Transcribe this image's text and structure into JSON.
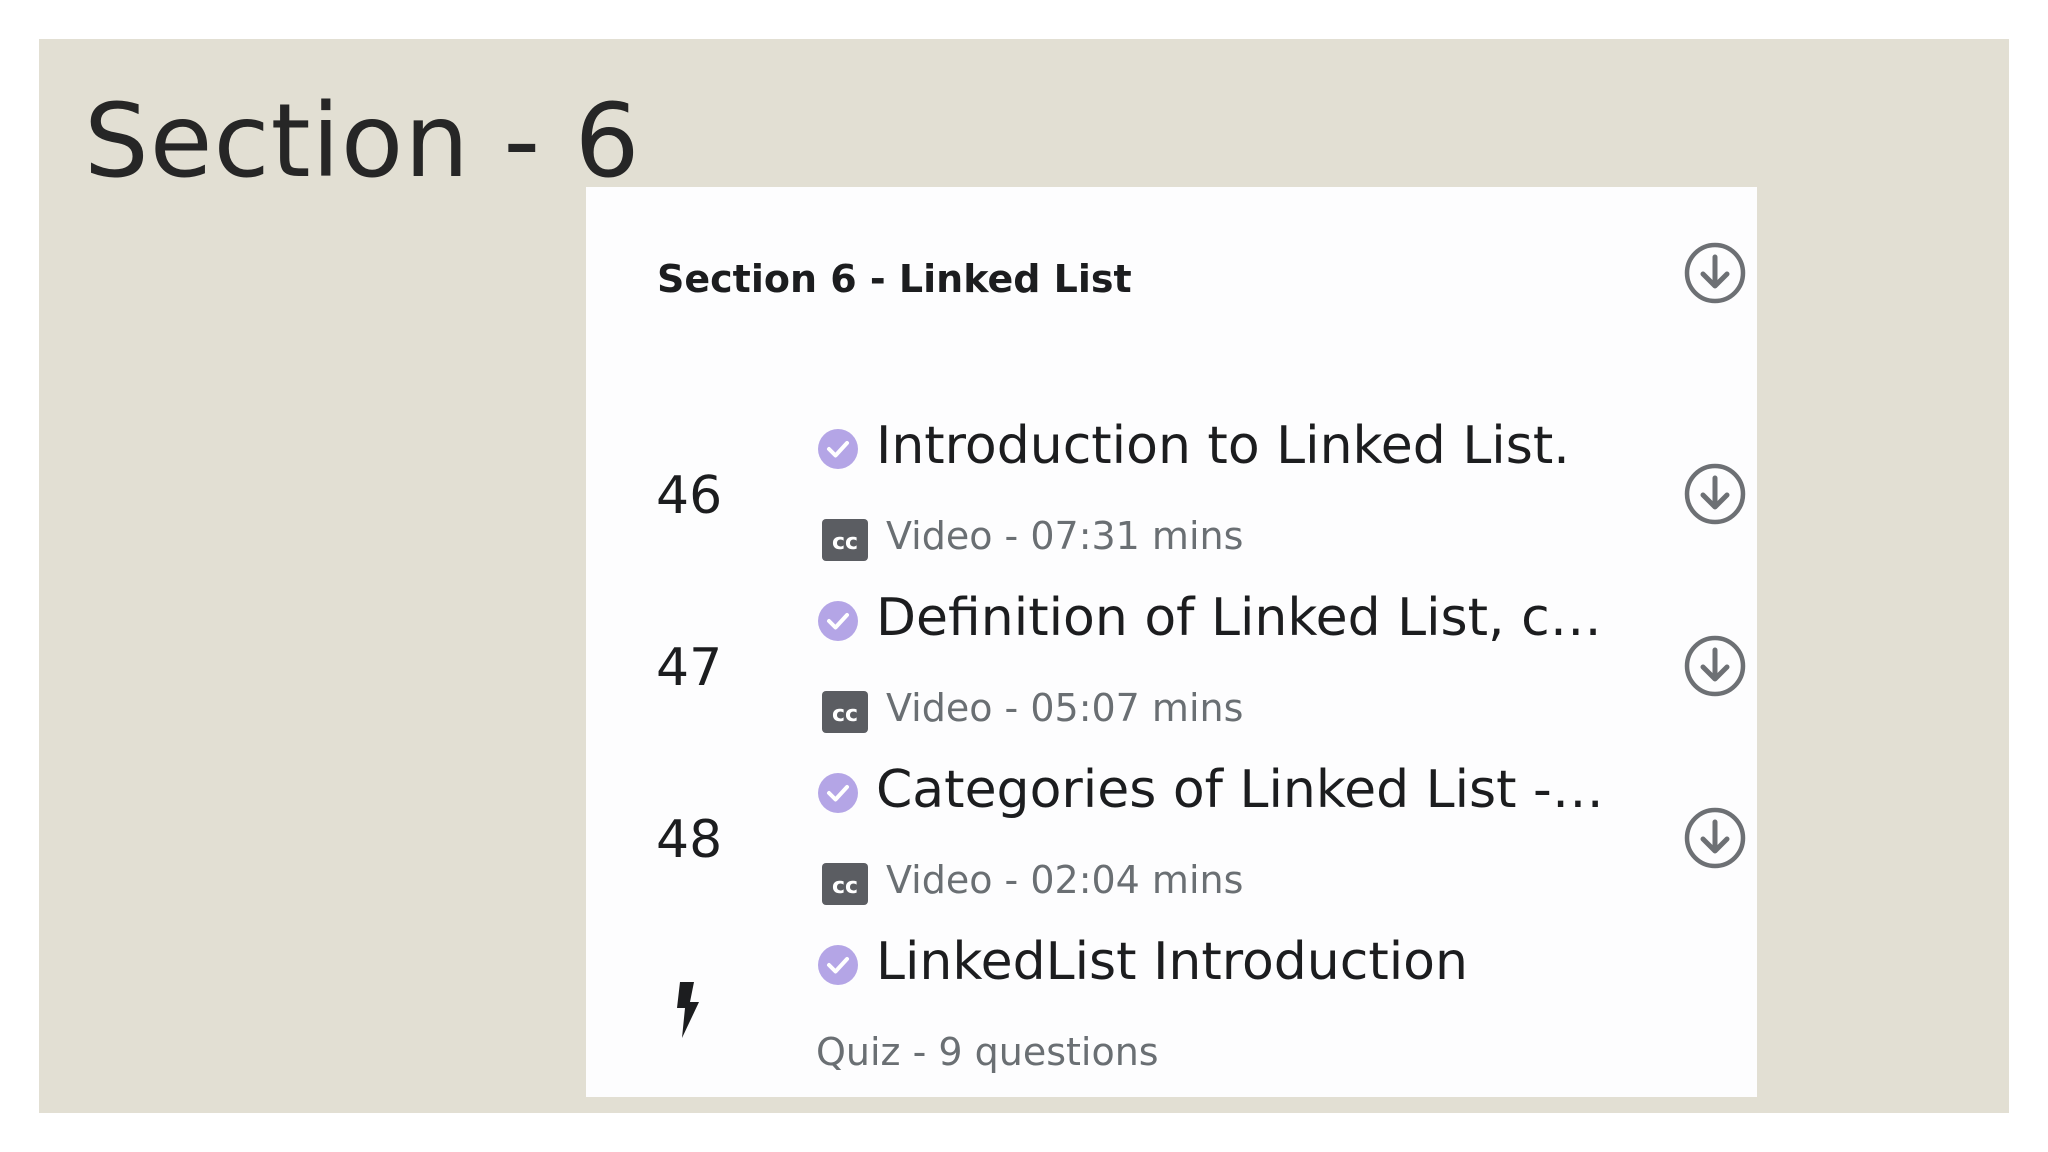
{
  "slide": {
    "title": "Section - 6"
  },
  "course": {
    "section_title": "Section 6 - Linked List",
    "items": [
      {
        "number": "46",
        "title": "Introduction to Linked List.",
        "meta": "Video - 07:31 mins",
        "icon": "closed-captions-icon",
        "completed": true
      },
      {
        "number": "47",
        "title": "Definition of Linked List, co…",
        "meta": "Video - 05:07 mins",
        "icon": "closed-captions-icon",
        "completed": true
      },
      {
        "number": "48",
        "title": "Categories of Linked List - S…",
        "meta": "Video - 02:04 mins",
        "icon": "closed-captions-icon",
        "completed": true
      }
    ],
    "quiz": {
      "title": "LinkedList Introduction",
      "meta": "Quiz - 9 questions",
      "icon": "lightning-bolt-icon",
      "completed": true
    }
  },
  "colors": {
    "slide_background": "#e2dfd3",
    "card_background": "#fdfdfe",
    "check_purple": "#b4a5e6",
    "icon_gray": "#5b5d62",
    "text_dark": "#1c1d1f",
    "text_muted": "#6a6f73"
  }
}
